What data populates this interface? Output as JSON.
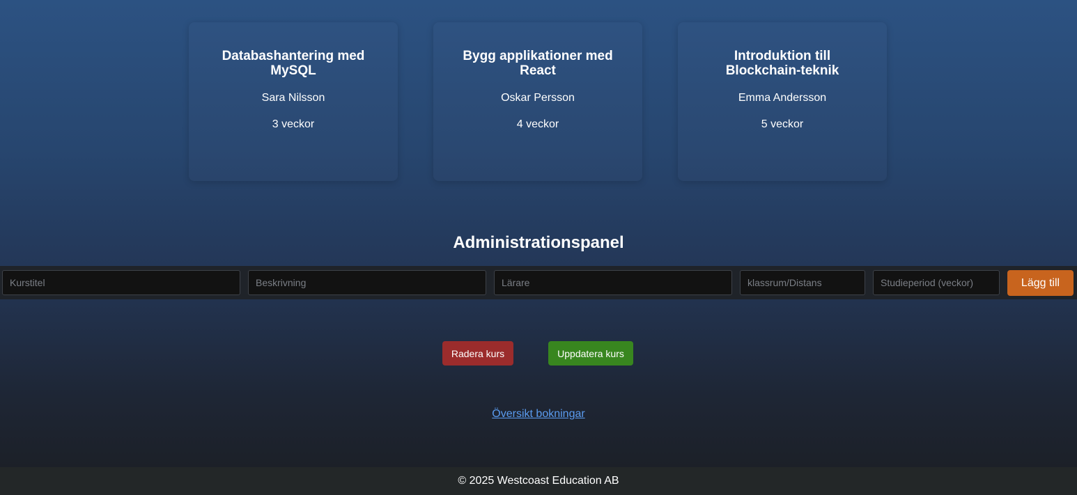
{
  "courses": [
    {
      "title": "Databashantering med MySQL",
      "teacher": "Sara Nilsson",
      "duration": "3 veckor"
    },
    {
      "title": "Bygg applikationer med React",
      "teacher": "Oskar Persson",
      "duration": "4 veckor"
    },
    {
      "title": "Introduktion till Blockchain-teknik",
      "teacher": "Emma Andersson",
      "duration": "5 veckor"
    }
  ],
  "admin": {
    "heading": "Administrationspanel",
    "form": {
      "title_placeholder": "Kurstitel",
      "description_placeholder": "Beskrivning",
      "teacher_placeholder": "Lärare",
      "location_placeholder": "klassrum/Distans",
      "period_placeholder": "Studieperiod (veckor)",
      "add_label": "Lägg till"
    },
    "delete_label": "Radera kurs",
    "update_label": "Uppdatera kurs"
  },
  "links": {
    "bookings_overview": "Översikt bokningar"
  },
  "footer": {
    "copyright": "© 2025 Westcoast Education AB"
  },
  "colors": {
    "add_button": "#c8641e",
    "delete_button": "#9b2c2c",
    "update_button": "#38861f",
    "link": "#5b9cf0"
  }
}
